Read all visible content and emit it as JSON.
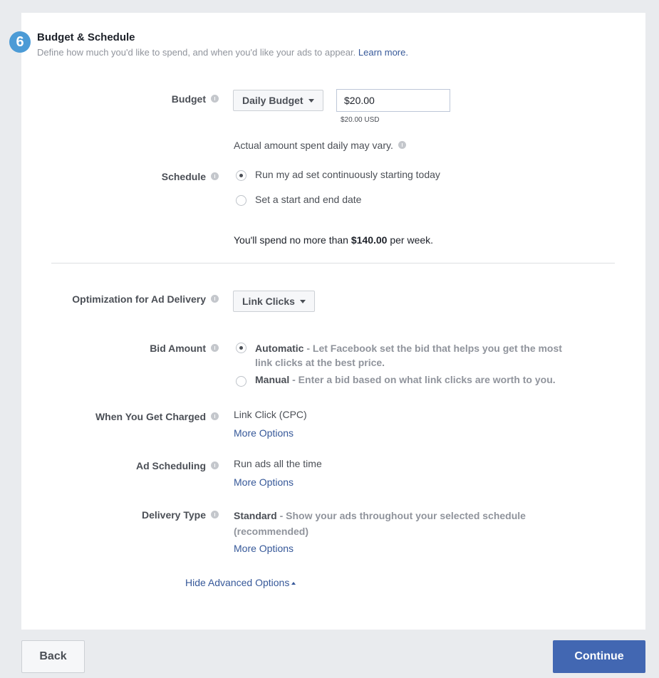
{
  "header": {
    "step_number": "6",
    "title": "Budget & Schedule",
    "subtitle": "Define how much you'd like to spend, and when you'd like your ads to appear.",
    "learn_more": "Learn more."
  },
  "budget": {
    "label": "Budget",
    "type_selected": "Daily Budget",
    "amount_value": "$20.00",
    "amount_usd": "$20.00 USD",
    "note": "Actual amount spent daily may vary."
  },
  "schedule": {
    "label": "Schedule",
    "options": [
      {
        "label": "Run my ad set continuously starting today",
        "checked": true
      },
      {
        "label": "Set a start and end date",
        "checked": false
      }
    ],
    "spend_prefix": "You'll spend no more than",
    "spend_amount": "$140.00",
    "spend_suffix": "per week."
  },
  "optimization": {
    "label": "Optimization for Ad Delivery",
    "selected": "Link Clicks"
  },
  "bid": {
    "label": "Bid Amount",
    "automatic_title": "Automatic",
    "automatic_desc_1": "- Let Facebook set the bid that helps you get the most",
    "automatic_desc_2": "link clicks at the best price.",
    "manual_title": "Manual",
    "manual_desc": "- Enter a bid based on what link clicks are worth to you."
  },
  "charged": {
    "label": "When You Get Charged",
    "value": "Link Click (CPC)",
    "more": "More Options"
  },
  "ad_scheduling": {
    "label": "Ad Scheduling",
    "value": "Run ads all the time",
    "more": "More Options"
  },
  "delivery": {
    "label": "Delivery Type",
    "value_title": "Standard",
    "value_desc_1": "- Show your ads throughout your selected schedule",
    "value_desc_2": "(recommended)",
    "more": "More Options"
  },
  "advanced": {
    "hide_label": "Hide Advanced Options"
  },
  "footer": {
    "back": "Back",
    "continue": "Continue"
  },
  "colors": {
    "accent": "#4267b2",
    "link": "#365899",
    "step_badge": "#4c9bd6"
  }
}
